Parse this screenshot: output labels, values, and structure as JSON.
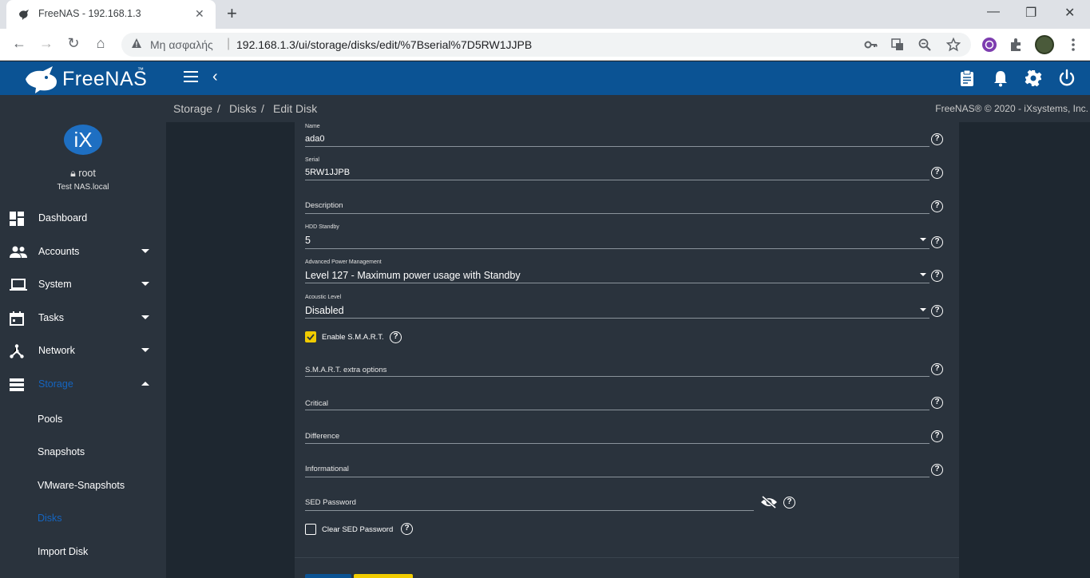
{
  "browser": {
    "tab_title": "FreeNAS - 192.168.1.3",
    "tab_close": "✕",
    "new_tab": "+",
    "security_label": "Μη ασφαλής",
    "url": "192.168.1.3/ui/storage/disks/edit/%7Bserial%7D5RW1JJPB",
    "controls": {
      "minimize": "—",
      "restore": "❐",
      "close": "✕"
    },
    "nav": {
      "back": "←",
      "forward": "→",
      "reload": "↻",
      "home": "⌂"
    },
    "icons": [
      "key-icon",
      "translate-icon",
      "zoom-icon",
      "star-icon",
      "viber-extension-icon",
      "extensions-icon",
      "profile-avatar",
      "menu-icon"
    ]
  },
  "app": {
    "brand": "FreeNAS",
    "brand_mark": "™",
    "header_icons": [
      "clipboard-icon",
      "bell-icon",
      "gear-icon",
      "power-icon"
    ],
    "accent": "#0b5394"
  },
  "sidebar": {
    "user": "root",
    "hostname": "Test NAS.local",
    "items": [
      {
        "label": "Dashboard",
        "icon": "dashboard-icon",
        "expandable": false
      },
      {
        "label": "Accounts",
        "icon": "people-icon",
        "expandable": true
      },
      {
        "label": "System",
        "icon": "laptop-icon",
        "expandable": true
      },
      {
        "label": "Tasks",
        "icon": "calendar-icon",
        "expandable": true
      },
      {
        "label": "Network",
        "icon": "network-icon",
        "expandable": true
      },
      {
        "label": "Storage",
        "icon": "storage-icon",
        "expandable": true,
        "active": true
      }
    ],
    "storage_sub": [
      "Pools",
      "Snapshots",
      "VMware-Snapshots",
      "Disks",
      "Import Disk"
    ],
    "active_sub": "Disks"
  },
  "breadcrumb": {
    "items": [
      "Storage",
      "Disks",
      "Edit Disk"
    ],
    "separator": "/",
    "copyright": "FreeNAS® © 2020 - iXsystems, Inc."
  },
  "form": {
    "name": {
      "label": "Name",
      "value": "ada0"
    },
    "serial": {
      "label": "Serial",
      "value": "5RW1JJPB"
    },
    "description": {
      "label": "Description",
      "value": ""
    },
    "hdd_standby": {
      "label": "HDD Standby",
      "value": "5"
    },
    "apm": {
      "label": "Advanced Power Management",
      "value": "Level 127 - Maximum power usage with Standby"
    },
    "acoustic": {
      "label": "Acoustic Level",
      "value": "Disabled"
    },
    "smart_enable": {
      "label": "Enable S.M.A.R.T.",
      "checked": true
    },
    "smart_options": {
      "label": "S.M.A.R.T. extra options"
    },
    "critical": {
      "label": "Critical"
    },
    "difference": {
      "label": "Difference"
    },
    "informational": {
      "label": "Informational"
    },
    "sed_password": {
      "label": "SED Password"
    },
    "clear_sed": {
      "label": "Clear SED Password",
      "checked": false
    },
    "help_glyph": "?"
  }
}
